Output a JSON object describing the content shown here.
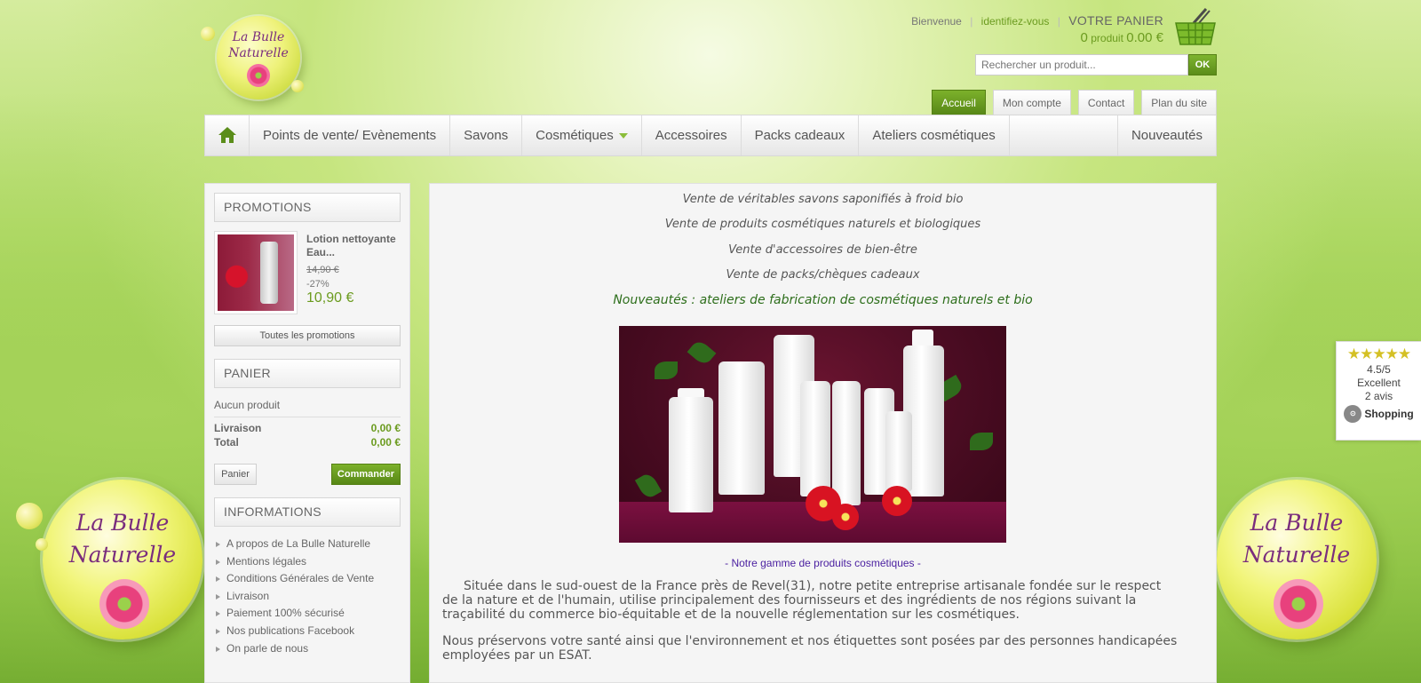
{
  "logo": {
    "line1": "La Bulle",
    "line2": "Naturelle"
  },
  "header": {
    "welcome": "Bienvenue",
    "login": "identifiez-vous",
    "cart_title": "VOTRE PANIER",
    "cart_count": "0",
    "cart_unit": "produit",
    "cart_amount": "0.00 €"
  },
  "search": {
    "placeholder": "Rechercher un produit...",
    "button": "OK"
  },
  "top_tabs": [
    "Accueil",
    "Mon compte",
    "Contact",
    "Plan du site"
  ],
  "nav": {
    "items": [
      "Points de vente/ Evènements",
      "Savons",
      "Cosmétiques",
      "Accessoires",
      "Packs cadeaux",
      "Ateliers cosmétiques"
    ],
    "last": "Nouveautés"
  },
  "promotions": {
    "title": "PROMOTIONS",
    "product_name": "Lotion nettoyante Eau...",
    "old_price": "14,90 €",
    "discount": "-27%",
    "price": "10,90 €",
    "all_button": "Toutes les promotions"
  },
  "cart_block": {
    "title": "PANIER",
    "empty": "Aucun produit",
    "shipping_label": "Livraison",
    "shipping_value": "0,00 €",
    "total_label": "Total",
    "total_value": "0,00 €",
    "cart_button": "Panier",
    "order_button": "Commander"
  },
  "informations": {
    "title": "INFORMATIONS",
    "links": [
      "A propos de La Bulle Naturelle",
      "Mentions légales",
      "Conditions Générales de Vente",
      "Livraison",
      "Paiement 100% sécurisé",
      "Nos publications Facebook",
      "On parle de nous"
    ]
  },
  "main": {
    "lines": [
      "Vente de véritables savons saponifiés à froid bio",
      "Vente de produits cosmétiques naturels et biologiques",
      "Vente d'accessoires de bien-être",
      "Vente de packs/chèques cadeaux"
    ],
    "headline": "Nouveautés : ateliers de fabrication de cosmétiques naturels et bio",
    "caption": "- Notre gamme de produits cosmétiques -",
    "para1": "Située dans le sud-ouest de la France près de Revel(31), notre petite entreprise artisanale fondée sur le respect de la nature et de l'humain, utilise principalement des fournisseurs et des ingrédients de nos régions suivant la traçabilité du commerce bio-équitable et de la nouvelle réglementation sur les cosmétiques.",
    "para2": "Nous préservons votre santé ainsi que l'environnement et nos étiquettes sont posées par des personnes handicapées employées par un ESAT."
  },
  "review_widget": {
    "stars": "★★★★★",
    "rating": "4.5/5",
    "label": "Excellent",
    "count": "2 avis",
    "brand": "Shopping",
    "rating_value": 4.5
  },
  "colors": {
    "accent_green": "#6b9b1f",
    "button_green": "#578716",
    "headline_green": "#2d6e1b",
    "caption_purple": "#4a1fa0"
  }
}
